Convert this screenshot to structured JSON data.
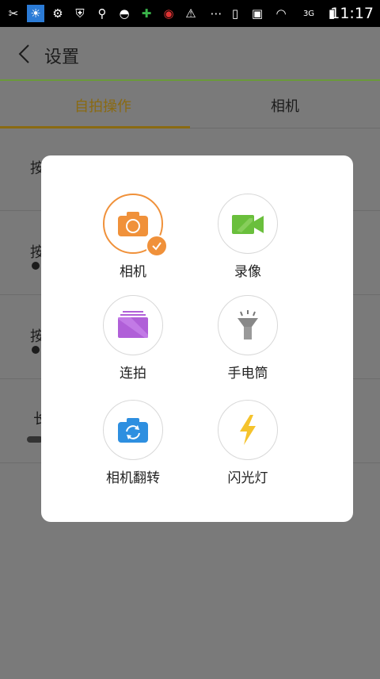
{
  "status_bar": {
    "time": "11:17",
    "network": "3G",
    "icons": [
      "scissors-icon",
      "weather-sun-icon",
      "android-icon",
      "shield-c-icon",
      "usb-icon",
      "android-head-icon",
      "game-icon",
      "app-icon",
      "warning-icon",
      "more-icon",
      "vibrate-icon",
      "image-icon",
      "wifi-icon",
      "signal-icon",
      "battery-icon"
    ]
  },
  "header": {
    "title": "设置"
  },
  "tabs": [
    {
      "label": "自拍操作",
      "active": true
    },
    {
      "label": "相机",
      "active": false
    }
  ],
  "rows": [
    {
      "text": "按"
    },
    {
      "text": "按"
    },
    {
      "text": "按"
    },
    {
      "text": "长"
    }
  ],
  "dialog": {
    "options": [
      {
        "label": "相机",
        "icon": "camera-icon",
        "selected": true
      },
      {
        "label": "录像",
        "icon": "video-icon",
        "selected": false
      },
      {
        "label": "连拍",
        "icon": "burst-icon",
        "selected": false
      },
      {
        "label": "手电筒",
        "icon": "flashlight-icon",
        "selected": false
      },
      {
        "label": "相机翻转",
        "icon": "camera-flip-icon",
        "selected": false
      },
      {
        "label": "闪光灯",
        "icon": "flash-icon",
        "selected": false
      }
    ]
  },
  "colors": {
    "accent": "#f0913a",
    "green": "#6abf3c",
    "purple": "#b05fd8",
    "blue": "#2e8fe0",
    "gold": "#f5c32c"
  }
}
